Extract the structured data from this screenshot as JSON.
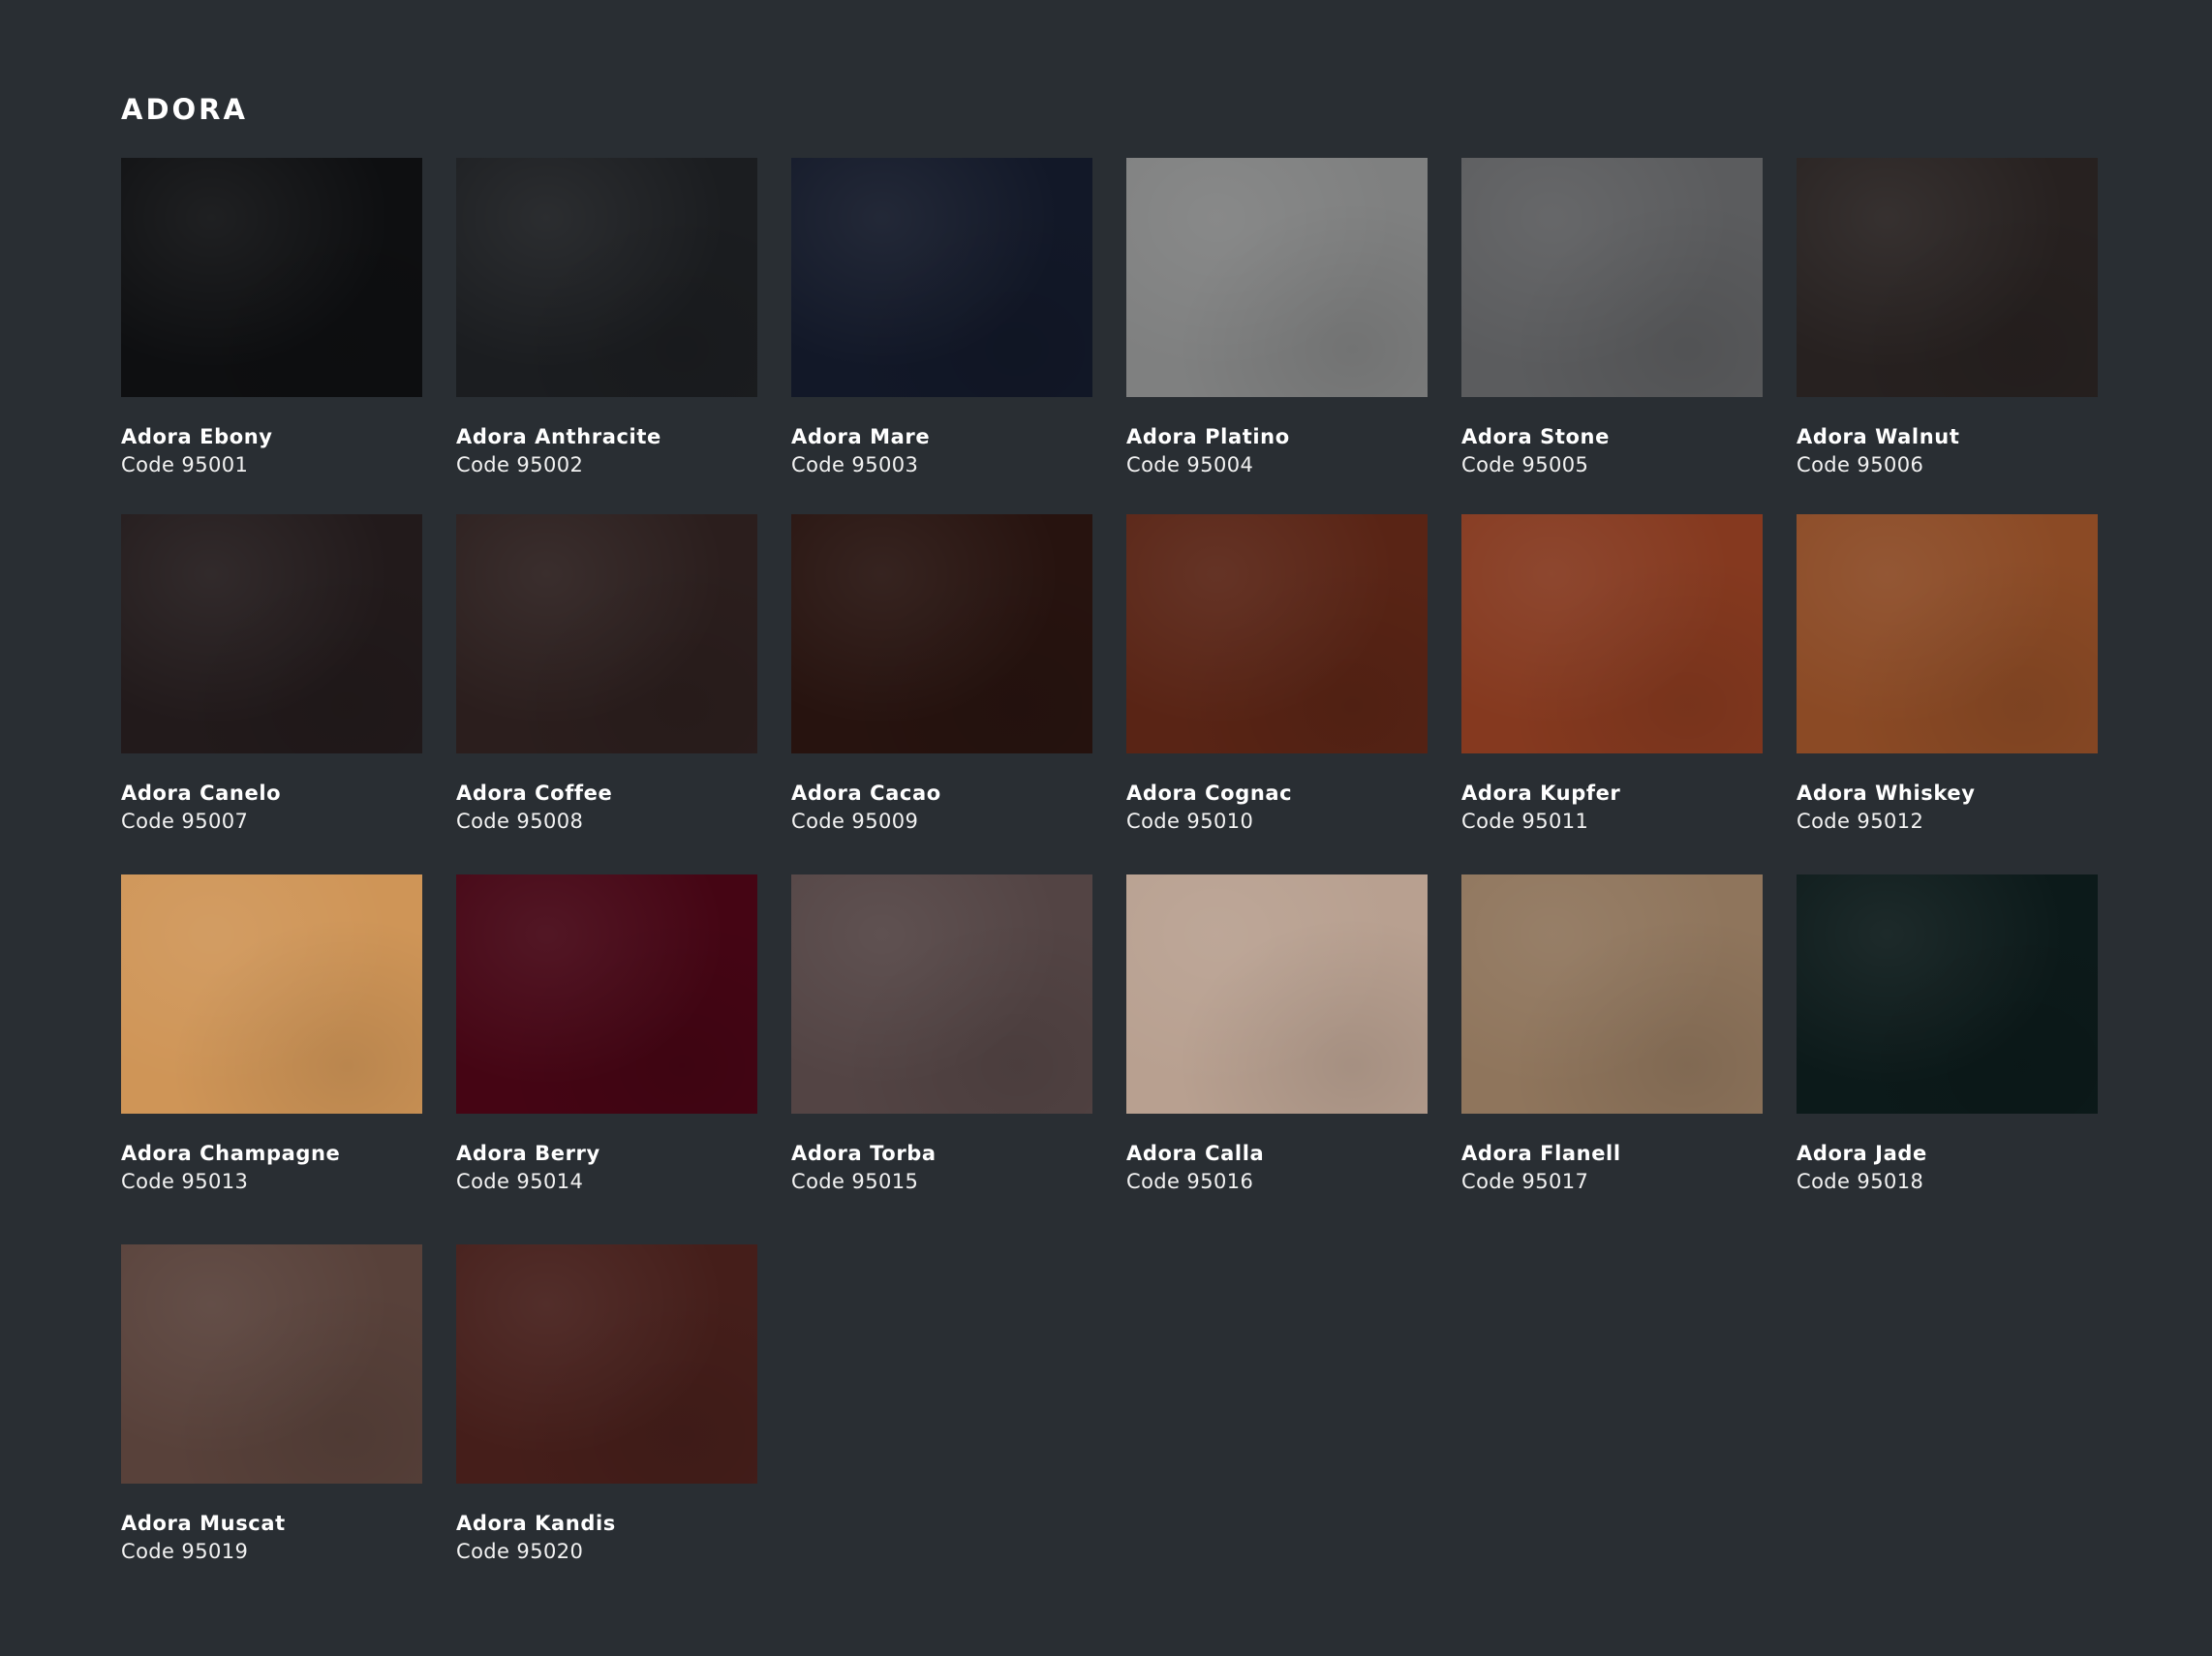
{
  "title": "ADORA",
  "swatches": [
    {
      "name": "Adora Ebony",
      "code": "Code 95001",
      "color": "#0e0f11"
    },
    {
      "name": "Adora Anthracite",
      "code": "Code 95002",
      "color": "#1b1d20"
    },
    {
      "name": "Adora Mare",
      "code": "Code 95003",
      "color": "#121828"
    },
    {
      "name": "Adora Platino",
      "code": "Code 95004",
      "color": "#7f8080"
    },
    {
      "name": "Adora Stone",
      "code": "Code 95005",
      "color": "#5b5c5e"
    },
    {
      "name": "Adora Walnut",
      "code": "Code 95006",
      "color": "#272120"
    },
    {
      "name": "Adora Canelo",
      "code": "Code 95007",
      "color": "#221a1b"
    },
    {
      "name": "Adora Coffee",
      "code": "Code 95008",
      "color": "#2b1e1d"
    },
    {
      "name": "Adora Cacao",
      "code": "Code 95009",
      "color": "#27130f"
    },
    {
      "name": "Adora Cognac",
      "code": "Code 95010",
      "color": "#592415"
    },
    {
      "name": "Adora Kupfer",
      "code": "Code 95011",
      "color": "#85391f"
    },
    {
      "name": "Adora Whiskey",
      "code": "Code 95012",
      "color": "#8b4a25"
    },
    {
      "name": "Adora Champagne",
      "code": "Code 95013",
      "color": "#cf9557"
    },
    {
      "name": "Adora Berry",
      "code": "Code 95014",
      "color": "#450514"
    },
    {
      "name": "Adora Torba",
      "code": "Code 95015",
      "color": "#534444"
    },
    {
      "name": "Adora Calla",
      "code": "Code 95016",
      "color": "#b8a090"
    },
    {
      "name": "Adora Flanell",
      "code": "Code 95017",
      "color": "#8f755c"
    },
    {
      "name": "Adora Jade",
      "code": "Code 95018",
      "color": "#0c1a1a"
    },
    {
      "name": "Adora Muscat",
      "code": "Code 95019",
      "color": "#58413a"
    },
    {
      "name": "Adora Kandis",
      "code": "Code 95020",
      "color": "#451e1a"
    }
  ]
}
